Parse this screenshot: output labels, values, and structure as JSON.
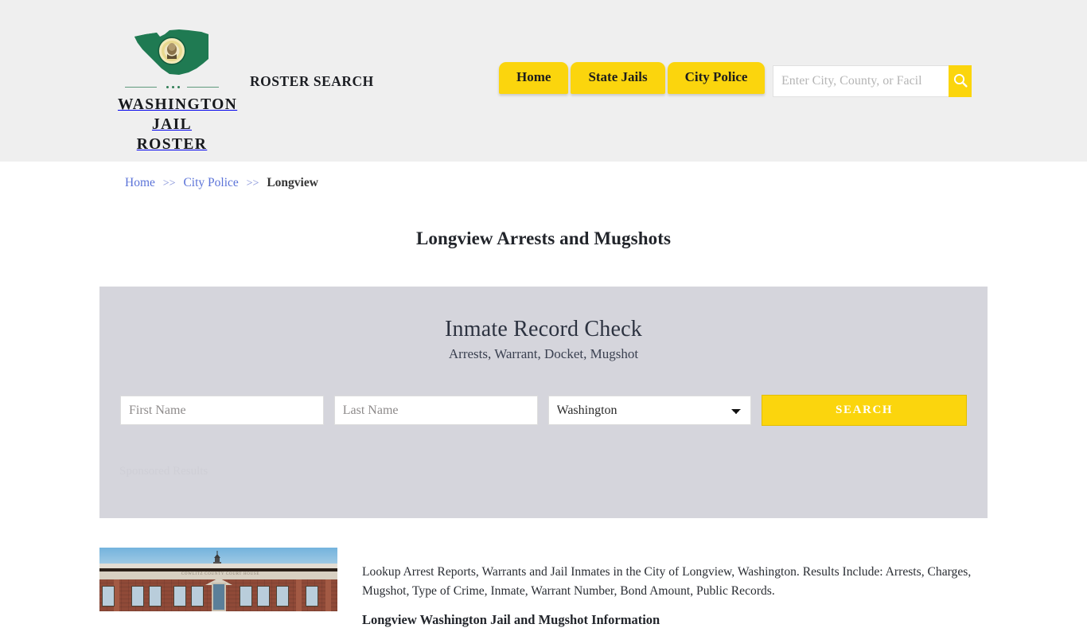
{
  "header": {
    "brand": {
      "logo_icon": "washington-state-flag-icon",
      "line1": "WASHINGTON",
      "line2": "JAIL ROSTER"
    },
    "tagline": "ROSTER SEARCH",
    "nav": [
      {
        "label": "Home"
      },
      {
        "label": "State Jails"
      },
      {
        "label": "City Police"
      }
    ],
    "search": {
      "value": "",
      "placeholder": "Enter City, County, or Facil",
      "button_icon": "search-icon"
    },
    "background_color": "#efefef",
    "accent_color": "#fbd50d"
  },
  "breadcrumb": {
    "items": [
      {
        "label": "Home",
        "link": true
      },
      {
        "label": "City Police",
        "link": true
      },
      {
        "label": "Longview",
        "link": false
      }
    ],
    "separator": ">>"
  },
  "page_title": "Longview Arrests and Mugshots",
  "search_panel": {
    "title": "Inmate Record Check",
    "subtitle": "Arrests, Warrant, Docket, Mugshot",
    "first_name": {
      "value": "",
      "placeholder": "First Name"
    },
    "last_name": {
      "value": "",
      "placeholder": "Last Name"
    },
    "state": {
      "selected": "Washington",
      "options": [
        "Washington"
      ]
    },
    "submit_label": "SEARCH",
    "sponsored_label": "Sponsored Results",
    "background_color": "#d5d5dc"
  },
  "content": {
    "thumbnail_alt": "COWLITZ COUNTY COURT HOUSE",
    "paragraph": "Lookup Arrest Reports, Warrants and Jail Inmates in the City of Longview, Washington. Results Include: Arrests, Charges, Mugshot, Type of Crime, Inmate, Warrant Number, Bond Amount, Public Records.",
    "subheading": "Longview Washington Jail and Mugshot Information"
  }
}
